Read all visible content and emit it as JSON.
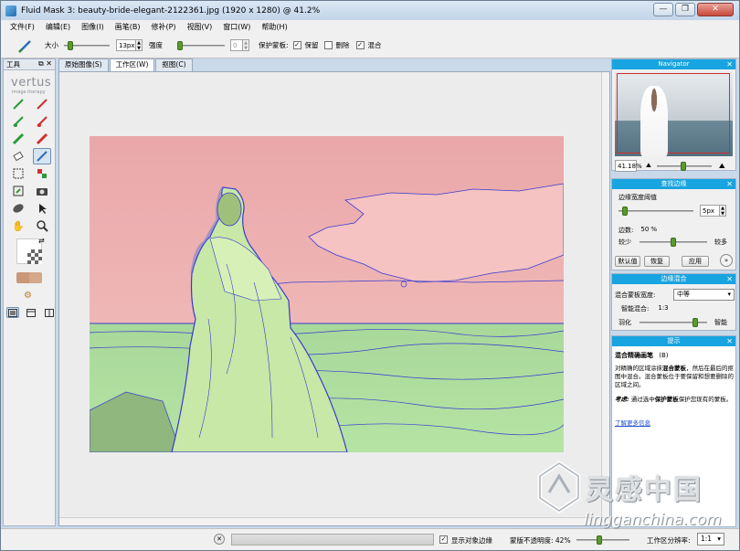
{
  "window": {
    "title": "Fluid Mask 3: beauty-bride-elegant-2122361.jpg (1920 x 1280) @ 41.2%",
    "minimize": "—",
    "maximize": "❐",
    "close": "✕"
  },
  "menu": [
    "文件(F)",
    "编辑(E)",
    "图像(I)",
    "画笔(B)",
    "修补(P)",
    "视图(V)",
    "窗口(W)",
    "帮助(H)"
  ],
  "options": {
    "size_label": "大小",
    "size_value": "13px",
    "strength_label": "强度",
    "strength_value": "0",
    "protect_label": "保护蒙板:",
    "keep_label": "保留",
    "keep_checked": true,
    "delete_label": "删除",
    "delete_checked": false,
    "blend_label": "混合",
    "blend_checked": true,
    "size_level": 0.1,
    "strength_level": 0.0
  },
  "tools_panel": {
    "title": "工具",
    "logo": "vertus",
    "logo_sub": "image therapy"
  },
  "tabs": [
    "原始图像(S)",
    "工作区(W)",
    "抠图(C)"
  ],
  "active_tab": 1,
  "navigator": {
    "title": "Navigator",
    "zoom": "41.18%"
  },
  "find_edges": {
    "title": "查找边缘",
    "threshold_label": "边缘宽度阈值",
    "threshold_value": "5px",
    "edge_label": "边数:",
    "edge_value": "50 %",
    "less_label": "较少",
    "more_label": "较多",
    "default_btn": "默认值",
    "restore_btn": "恢复",
    "apply_btn": "应用",
    "threshold_level": 0.05,
    "edge_level": 0.5
  },
  "edge_blend": {
    "title": "边缘混合",
    "width_label": "混合蒙板宽度:",
    "width_value": "中等",
    "smart_label": "智能混合:",
    "smart_value": "1:3",
    "feather_label": "羽化",
    "smart2_label": "智能",
    "feather_level": 0.85
  },
  "hints": {
    "title": "提示",
    "heading": "混合精确画笔",
    "heading_key": "(B)",
    "body1a": "对精确的区域涂抹",
    "body1b": "混合蒙板",
    "body1c": "，然后在最后的抠图中混合。混合蒙板位于要保留和想要删除的区域之间。",
    "tip_label": "考虑:",
    "tip_a": "通过选中",
    "tip_b": "保护蒙板",
    "tip_c": "保护您现有的蒙板。",
    "link": "了解更多信息"
  },
  "status": {
    "show_edges_label": "显示对象边缘",
    "show_edges_checked": true,
    "opacity_label": "蒙版不透明度: 42%",
    "opacity_level": 0.42,
    "resolution_label": "工作区分辨率:",
    "resolution_value": "1:1"
  },
  "watermark": {
    "text": "灵感中国",
    "url": "lingganchina.com"
  }
}
